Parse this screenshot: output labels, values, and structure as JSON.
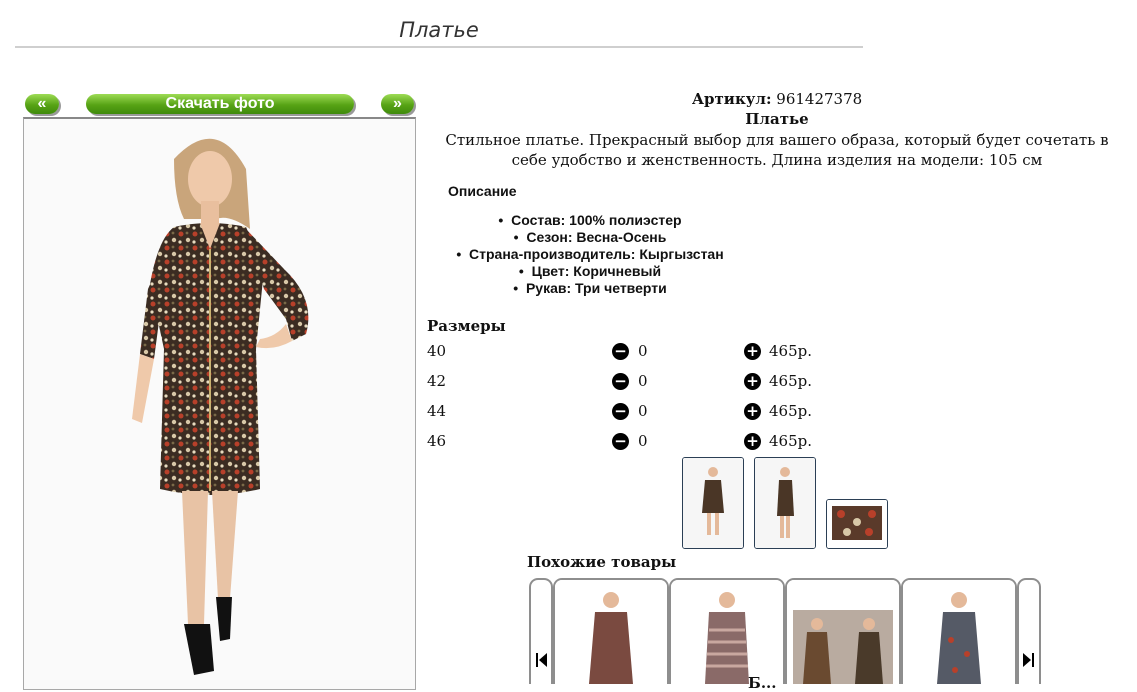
{
  "page": {
    "title": "Платье"
  },
  "nav": {
    "prev_label": "«",
    "download_label": "Скачать фото",
    "next_label": "»"
  },
  "product": {
    "article_label": "Артикул:",
    "article_value": "961427378",
    "name": "Платье",
    "description": "Стильное платье. Прекрасный выбор для вашего образа, который будет сочетать в себе удобство и женственность. Длина изделия на модели: 105 см",
    "details_heading": "Описание",
    "attributes": [
      "Состав: 100% полиэстер",
      "Сезон: Весна-Осень",
      "Страна-производитель: Кыргызстан",
      "Цвет: Коричневый",
      "Рукав: Три четверти"
    ]
  },
  "sizes": {
    "heading": "Размеры",
    "rows": [
      {
        "size": "40",
        "qty": "0",
        "price": "465р."
      },
      {
        "size": "42",
        "qty": "0",
        "price": "465р."
      },
      {
        "size": "44",
        "qty": "0",
        "price": "465р."
      },
      {
        "size": "46",
        "qty": "0",
        "price": "465р."
      }
    ]
  },
  "similar": {
    "heading": "Похожие товары",
    "partial_caption": "Б..."
  },
  "colors": {
    "accent_green": "#57a315",
    "thumb_border": "#2b3f55",
    "card_border": "#8e8e8e"
  }
}
